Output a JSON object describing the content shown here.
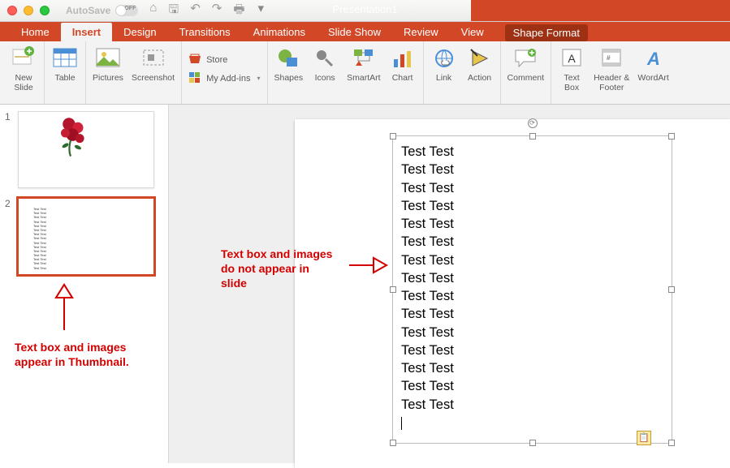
{
  "titlebar": {
    "autosave_label": "AutoSave",
    "autosave_state": "OFF",
    "presentation_title": "Presentation1"
  },
  "tabs": {
    "home": "Home",
    "insert": "Insert",
    "design": "Design",
    "transitions": "Transitions",
    "animations": "Animations",
    "slideshow": "Slide Show",
    "review": "Review",
    "view": "View",
    "shape_format": "Shape Format"
  },
  "ribbon": {
    "new_slide": "New\nSlide",
    "table": "Table",
    "pictures": "Pictures",
    "screenshot": "Screenshot",
    "store": "Store",
    "my_addins": "My Add-ins",
    "shapes": "Shapes",
    "icons": "Icons",
    "smartart": "SmartArt",
    "chart": "Chart",
    "link": "Link",
    "action": "Action",
    "comment": "Comment",
    "text_box": "Text\nBox",
    "header_footer": "Header &\nFooter",
    "wordart": "WordArt"
  },
  "thumbnails": {
    "slide1_num": "1",
    "slide2_num": "2"
  },
  "textbox_lines": [
    "Test Test",
    "Test Test",
    "Test Test",
    "Test Test",
    "Test Test",
    "Test Test",
    "Test Test",
    "Test Test",
    "Test Test",
    "Test Test",
    "Test Test",
    "Test Test",
    "Test Test",
    "Test Test",
    "Test Test"
  ],
  "thumb2_lines": [
    "Test Test",
    "Test Test",
    "Test Test",
    "Test Test",
    "Test Test",
    "Test Test",
    "Test Test",
    "Test Test",
    "Test Test",
    "Test Test",
    "Test Test",
    "Test Test",
    "Test Test",
    "Test Test",
    "Test Test"
  ],
  "annotations": {
    "thumb_note": "Text box and images\nappear in Thumbnail.",
    "slide_note": "Text box and images\ndo not appear in\nslide"
  }
}
